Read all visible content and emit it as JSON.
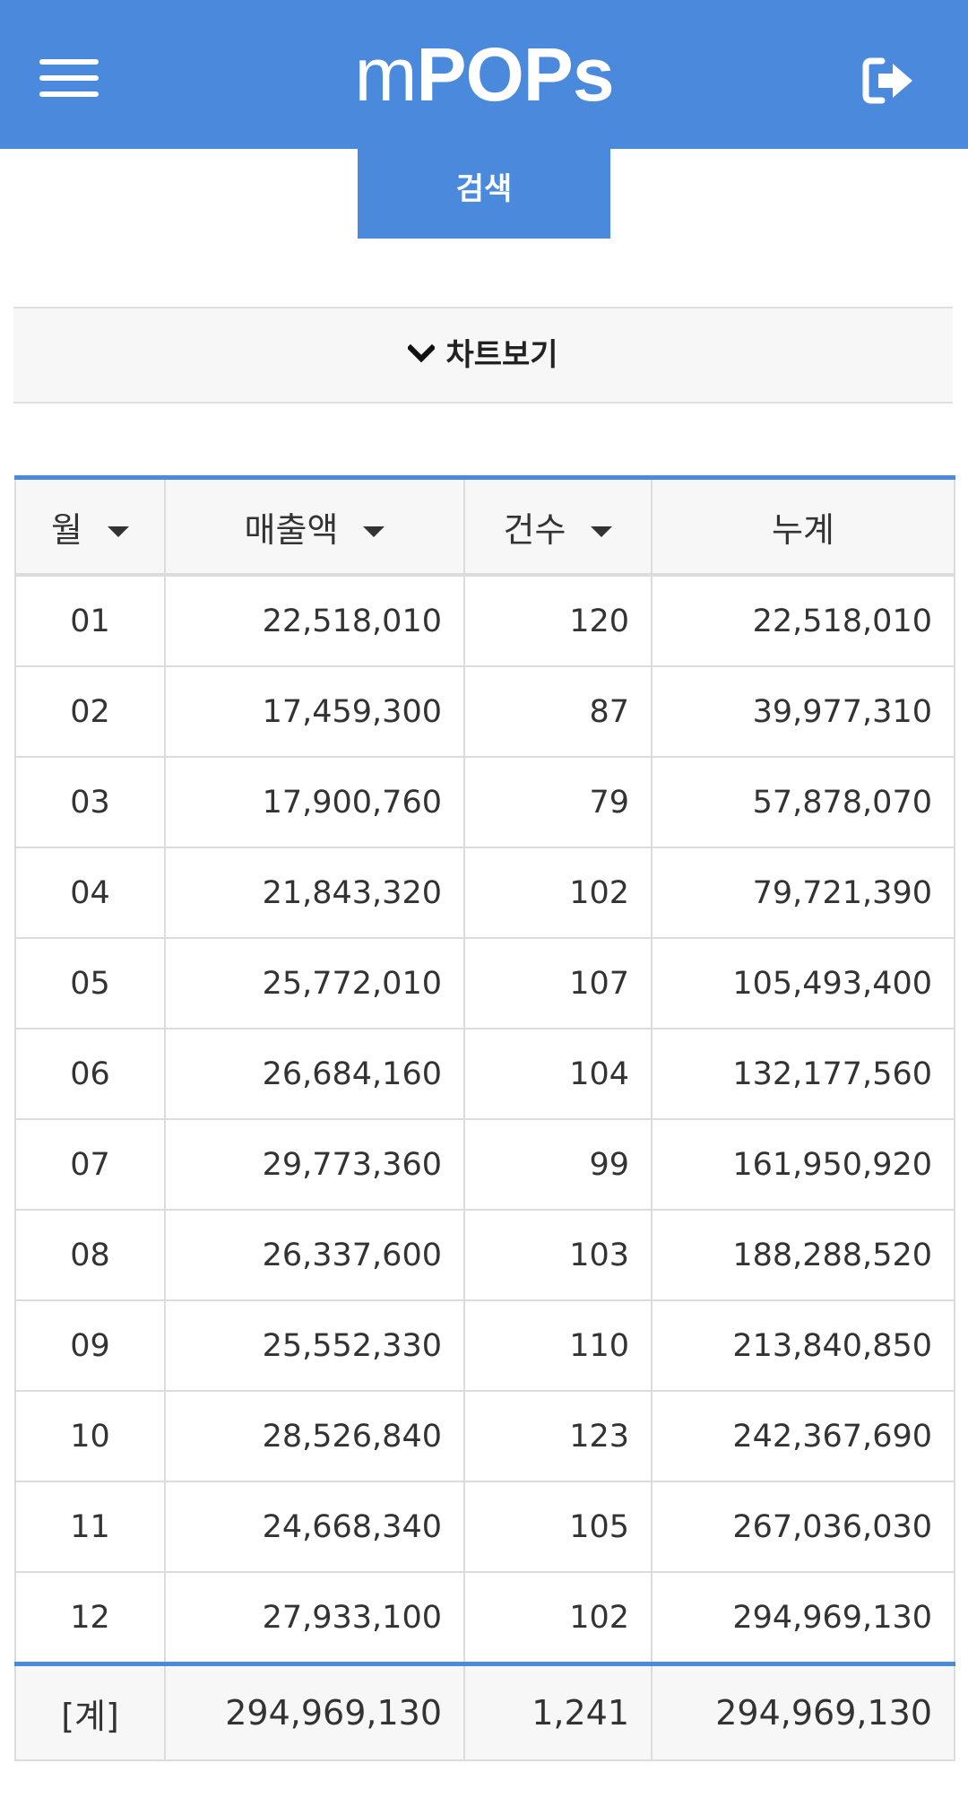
{
  "app": {
    "logo_lower": "m",
    "logo_upper": "POPs"
  },
  "search": {
    "label": "검색"
  },
  "chart_toggle": {
    "label": "차트보기"
  },
  "table": {
    "headers": [
      "월",
      "매출액",
      "건수",
      "누계"
    ],
    "rows": [
      [
        "01",
        "22,518,010",
        "120",
        "22,518,010"
      ],
      [
        "02",
        "17,459,300",
        "87",
        "39,977,310"
      ],
      [
        "03",
        "17,900,760",
        "79",
        "57,878,070"
      ],
      [
        "04",
        "21,843,320",
        "102",
        "79,721,390"
      ],
      [
        "05",
        "25,772,010",
        "107",
        "105,493,400"
      ],
      [
        "06",
        "26,684,160",
        "104",
        "132,177,560"
      ],
      [
        "07",
        "29,773,360",
        "99",
        "161,950,920"
      ],
      [
        "08",
        "26,337,600",
        "103",
        "188,288,520"
      ],
      [
        "09",
        "25,552,330",
        "110",
        "213,840,850"
      ],
      [
        "10",
        "28,526,840",
        "123",
        "242,367,690"
      ],
      [
        "11",
        "24,668,340",
        "105",
        "267,036,030"
      ],
      [
        "12",
        "27,933,100",
        "102",
        "294,969,130"
      ]
    ],
    "total": [
      "[계]",
      "294,969,130",
      "1,241",
      "294,969,130"
    ]
  },
  "colors": {
    "brand": "#4a89dc",
    "header_bg": "#f7f7f7",
    "border": "#dcdcdc"
  },
  "icons": {
    "menu": "hamburger-menu-icon",
    "logout": "sign-out-icon",
    "toggle": "chevron-down-icon",
    "sort": "caret-down-icon"
  }
}
